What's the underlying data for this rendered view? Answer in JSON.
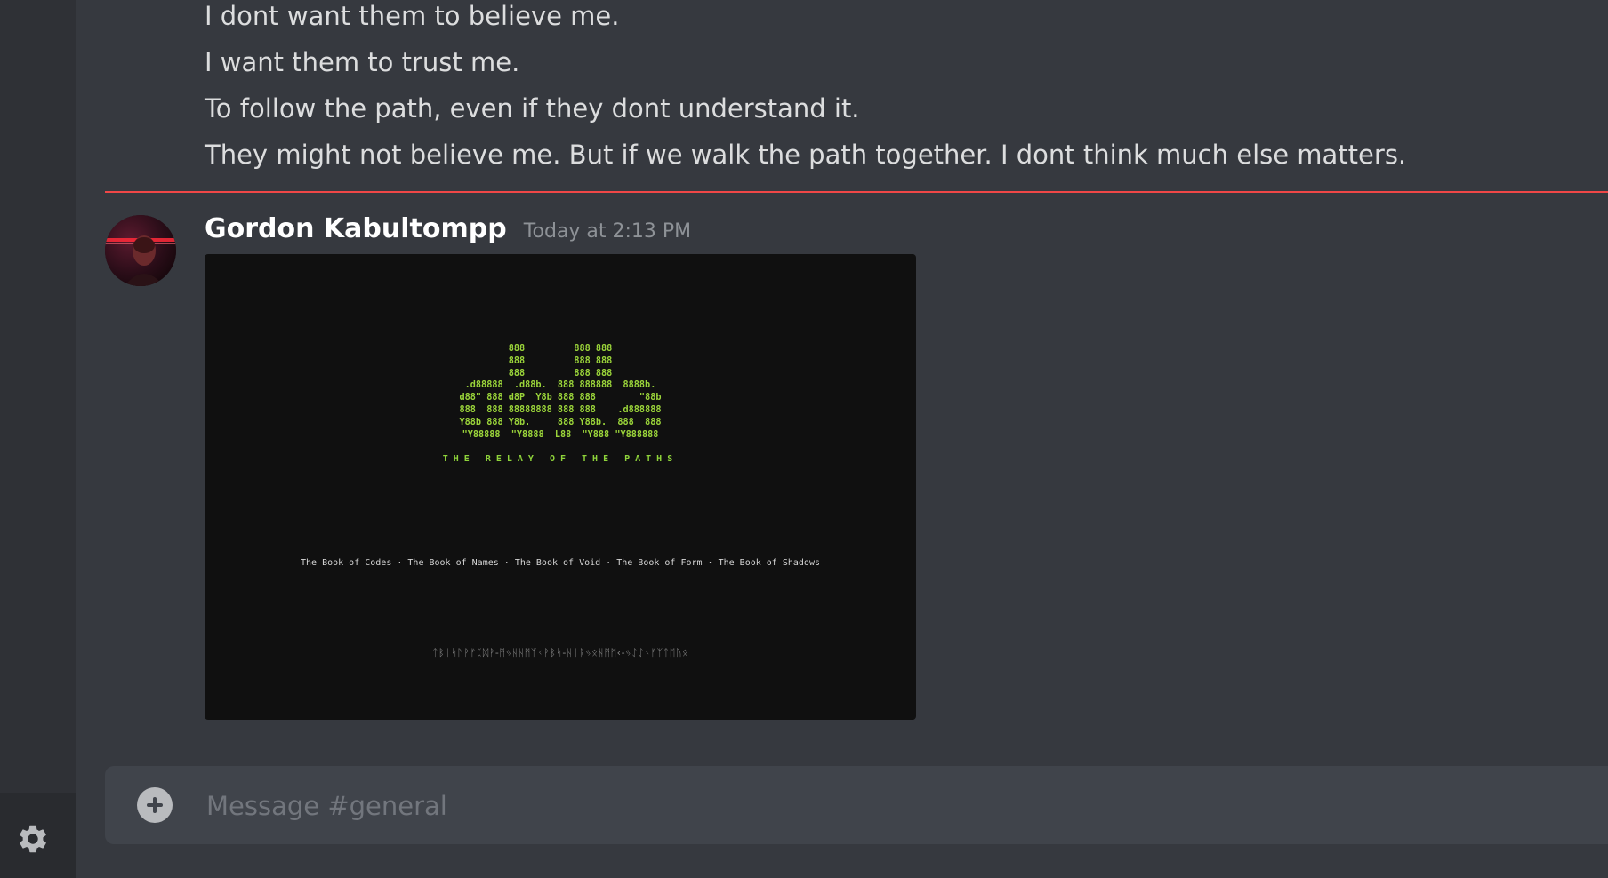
{
  "previous_message": {
    "lines": [
      "I dont want them to believe me.",
      "I want them to trust me.",
      "To follow the path, even if they dont understand it.",
      "They might not believe me. But if we walk the path together. I dont think much else matters."
    ]
  },
  "message": {
    "author": "Gordon Kabultompp",
    "timestamp": "Today at 2:13 PM",
    "attachment": {
      "ascii_art": "888         888 888\n888         888 888\n888         888 888\n.d88888  .d88b.  888 888888  8888b.\nd88\" 888 d8P  Y8b 888 888        \"88b\n888  888 88888888 888 888    .d888888\nY88b 888 Y8b.     888 Y88b.  888  888\n\"Y88888  \"Y8888  L88  \"Y888 \"Y888888",
      "title": "THE RELAY OF THE PATHS",
      "books": "The Book of Codes · The Book of Names · The Book of Void · The Book of Form · The Book of Shadows",
      "runes": "ᛏᛒᛁᛋᚢᚹᚠᛈᛞᚹ-ᛗᛃᚺᚺᛗᛉᚲᚹᛒᛋ-ᚺᛁᚱᛃᛟᚺᛗᛗ‹-ᛃᛇᛇᚾᚠᛉᛏᛖᚢᛟ"
    },
    "colors": {
      "ascii": "#9bd53a",
      "author": "#ffffff",
      "timestamp": "#8e9297"
    }
  },
  "composer": {
    "placeholder": "Message #general"
  },
  "icons": {
    "settings": "gear-icon",
    "add": "plus-circle-icon"
  },
  "colors": {
    "background": "#36393f",
    "new_messages_divider": "#f04747"
  }
}
